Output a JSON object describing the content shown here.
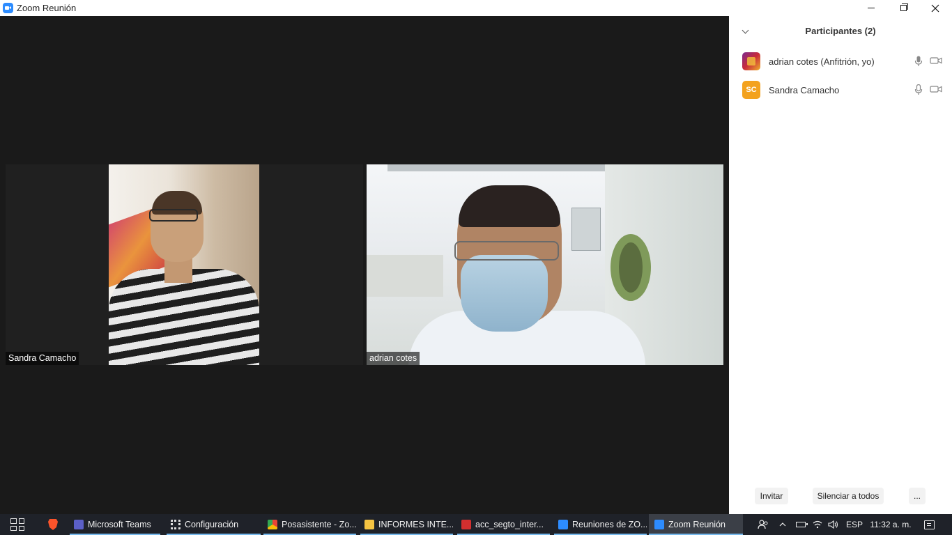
{
  "window": {
    "title": "Zoom Reunión",
    "icon": "zoom-icon"
  },
  "video": {
    "tiles": [
      {
        "name": "Sandra Camacho"
      },
      {
        "name": "adrian cotes"
      }
    ]
  },
  "participants": {
    "title": "Participantes (2)",
    "list": [
      {
        "name": "adrian cotes (Anfitrión, yo)",
        "avatar": "profile-image"
      },
      {
        "name": "Sandra Camacho",
        "avatar_initials": "SC",
        "avatar_color": "#f3a21e"
      }
    ],
    "buttons": {
      "invite": "Invitar",
      "mute_all": "Silenciar a todos",
      "more": "..."
    }
  },
  "taskbar": {
    "items": [
      {
        "label": "Microsoft Teams",
        "icon": "teams-icon"
      },
      {
        "label": "Configuración",
        "icon": "gear-icon"
      },
      {
        "label": "Posasistente - Zo...",
        "icon": "chrome-icon"
      },
      {
        "label": "INFORMES INTE...",
        "icon": "folder-icon"
      },
      {
        "label": "acc_segto_inter...",
        "icon": "pdf-icon"
      },
      {
        "label": "Reuniones de ZO...",
        "icon": "zoom-icon"
      },
      {
        "label": "Zoom Reunión",
        "icon": "zoom-icon"
      }
    ],
    "tray": {
      "language": "ESP",
      "time": "11:32 a. m."
    }
  },
  "colors": {
    "accent": "#2d8cff",
    "stage_bg": "#1a1a1a",
    "taskbar_bg": "#1f2229"
  }
}
